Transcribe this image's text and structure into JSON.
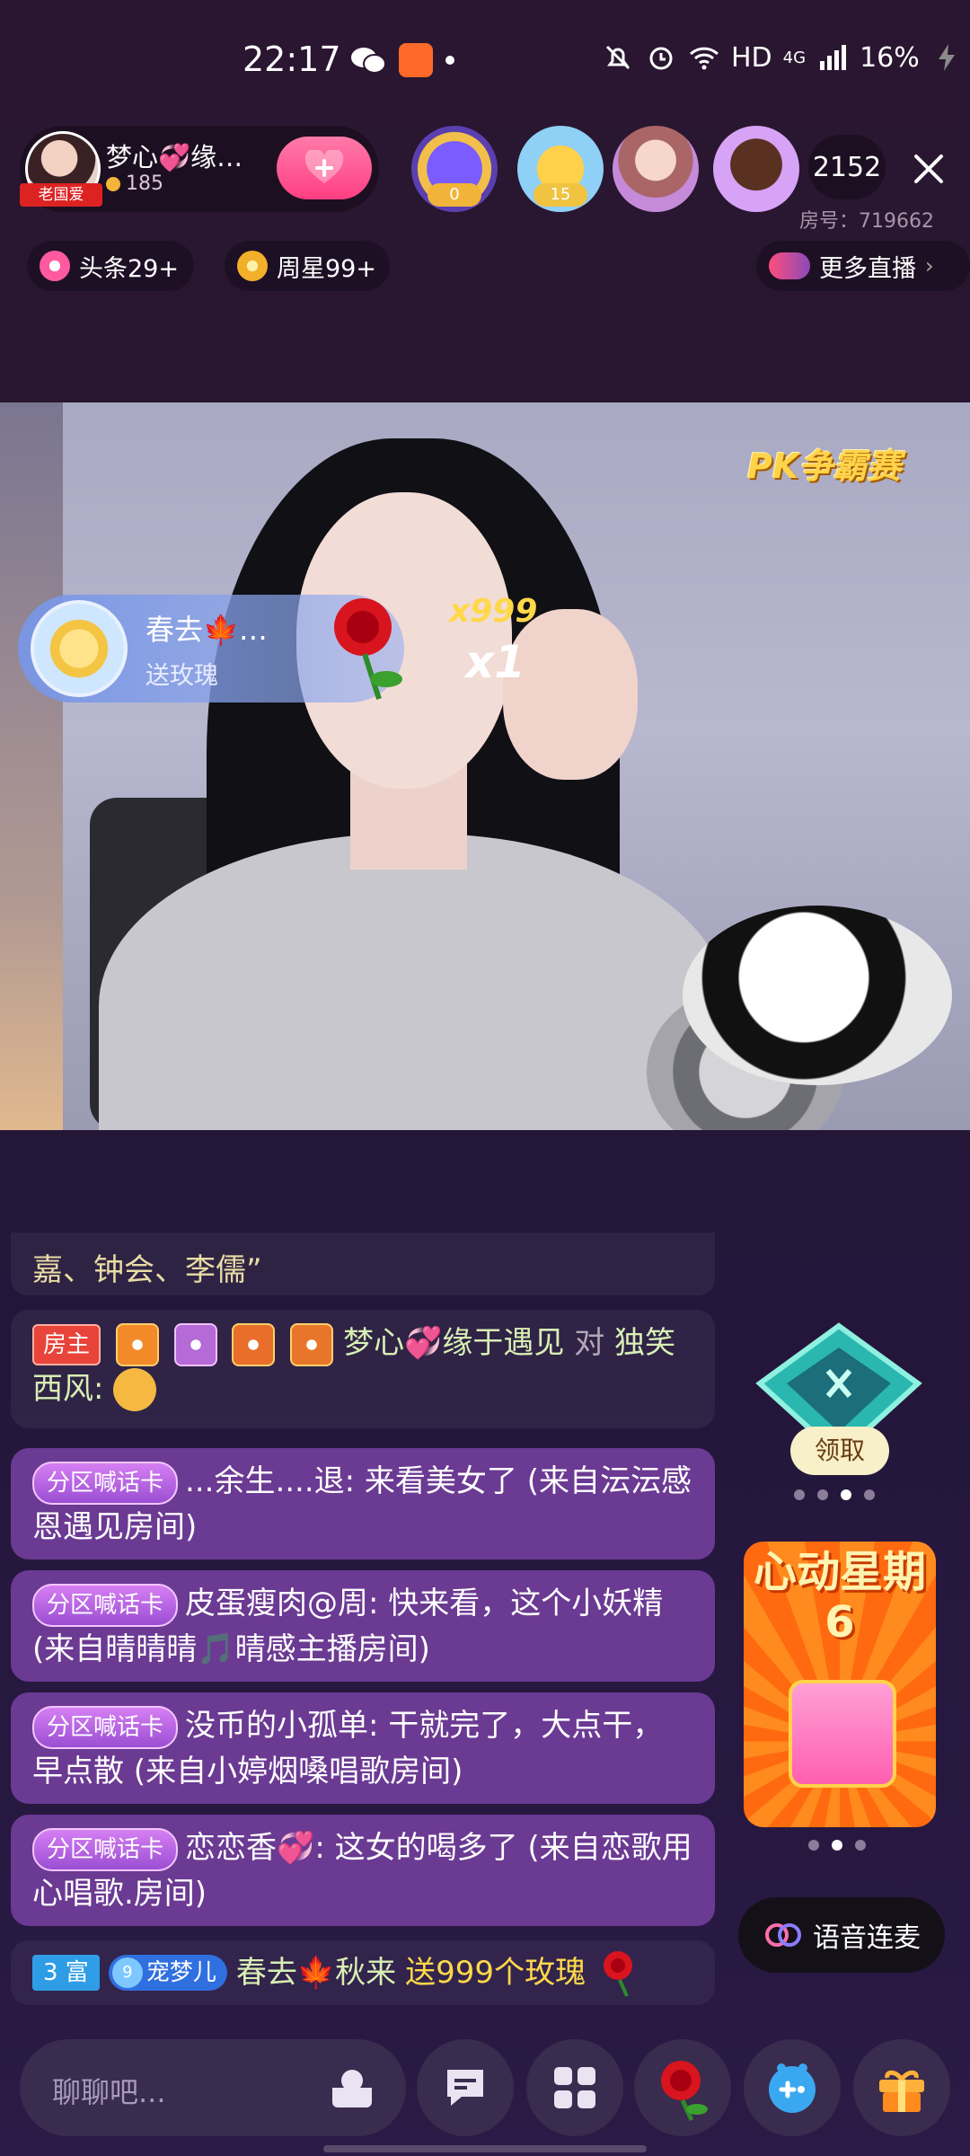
{
  "status_bar": {
    "time": "22:17",
    "network_label": "HD",
    "signal_label": "4G",
    "battery": "16%"
  },
  "header": {
    "host_name": "梦心💞缘…",
    "host_tag": "老国爱",
    "host_coins": "185",
    "viewer_badges": [
      "0",
      "15"
    ],
    "viewer_count": "2152",
    "room_number": "房号：719662",
    "tags": {
      "headline": "头条29+",
      "weekstar": "周星99+",
      "more_live": "更多直播"
    }
  },
  "video": {
    "pk_logo": "PK争霸赛",
    "gift_banner": {
      "sender": "春去🍁…",
      "action": "送玫瑰",
      "count_total": "x999",
      "count_combo": "x1"
    }
  },
  "chat": {
    "fade_text": "嘉、钟会、李儒”",
    "host_message": {
      "badge": "房主",
      "sender": "梦心💞缘于遇见",
      "to": "对",
      "receiver": "独笑",
      "receiver_cont": "西风:"
    },
    "card_messages": [
      {
        "tag": "分区喊话卡",
        "text": "...余生....退: 来看美女了 (来自沄沄感恩遇见房间)"
      },
      {
        "tag": "分区喊话卡",
        "text": "皮蛋瘦肉@周: 快来看，这个小妖精 (来自晴晴晴🎵晴感主播房间)"
      },
      {
        "tag": "分区喊话卡",
        "text": "没币的小孤单: 干就完了，大点干，早点散 (来自小婷烟嗓唱歌房间)"
      },
      {
        "tag": "分区喊话卡",
        "text": "恋恋香💞: 这女的喝多了 (来自恋歌用心唱歌.房间)"
      }
    ],
    "gift_message": {
      "rich_badge": "3 富",
      "pet_level": "9",
      "pet_badge": "宠梦儿",
      "sender": "春去🍁秋来",
      "gift_text": "送999个玫瑰"
    }
  },
  "side": {
    "claim_label": "领取",
    "promo_title": "心动星期6",
    "voice_label": "语音连麦"
  },
  "bottom_bar": {
    "input_placeholder": "聊聊吧..."
  },
  "colors": {
    "background": "#2a1630",
    "card_purple": "#6b3a93",
    "accent_pink": "#ff3f83",
    "gold": "#ffd84a"
  }
}
